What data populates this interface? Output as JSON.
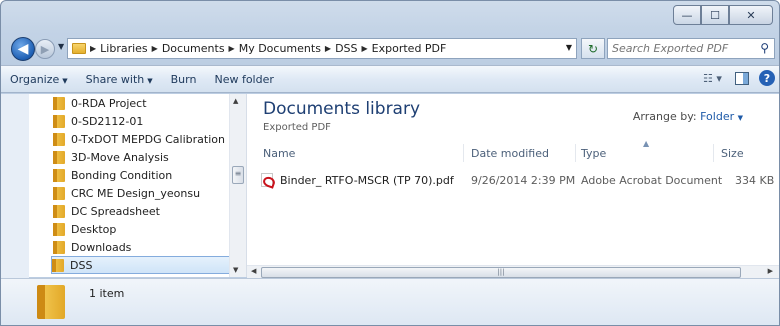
{
  "window": {
    "caption": {
      "minimize": "—",
      "maximize": "☐",
      "close": "✕"
    }
  },
  "nav": {
    "back_glyph": "◀",
    "forward_glyph": "▶",
    "breadcrumbs": [
      "Libraries",
      "Documents",
      "My Documents",
      "DSS",
      "Exported PDF"
    ],
    "search_placeholder": "Search Exported PDF"
  },
  "commands": {
    "organize": "Organize",
    "share_with": "Share with",
    "burn": "Burn",
    "new_folder": "New folder"
  },
  "tree": {
    "items": [
      {
        "label": "0-RDA Project"
      },
      {
        "label": "0-SD2112-01"
      },
      {
        "label": "0-TxDOT MEPDG Calibration"
      },
      {
        "label": "3D-Move Analysis"
      },
      {
        "label": "Bonding Condition"
      },
      {
        "label": "CRC ME Design_yeonsu"
      },
      {
        "label": "DC Spreadsheet"
      },
      {
        "label": "Desktop"
      },
      {
        "label": "Downloads"
      },
      {
        "label": "DSS"
      }
    ],
    "selected_index": 9
  },
  "library": {
    "title": "Documents library",
    "subtitle": "Exported PDF",
    "arrange_label": "Arrange by:",
    "arrange_value": "Folder"
  },
  "columns": {
    "name": "Name",
    "date": "Date modified",
    "type": "Type",
    "size": "Size"
  },
  "files": [
    {
      "name": "Binder_ RTFO-MSCR (TP 70).pdf",
      "date": "9/26/2014 2:39 PM",
      "type": "Adobe Acrobat Document",
      "size": "334 KB"
    }
  ],
  "details": {
    "count": "1 item"
  },
  "colors": {
    "accent": "#1e3f73",
    "link": "#1e5aa8",
    "selection": "#cfe4f8"
  }
}
